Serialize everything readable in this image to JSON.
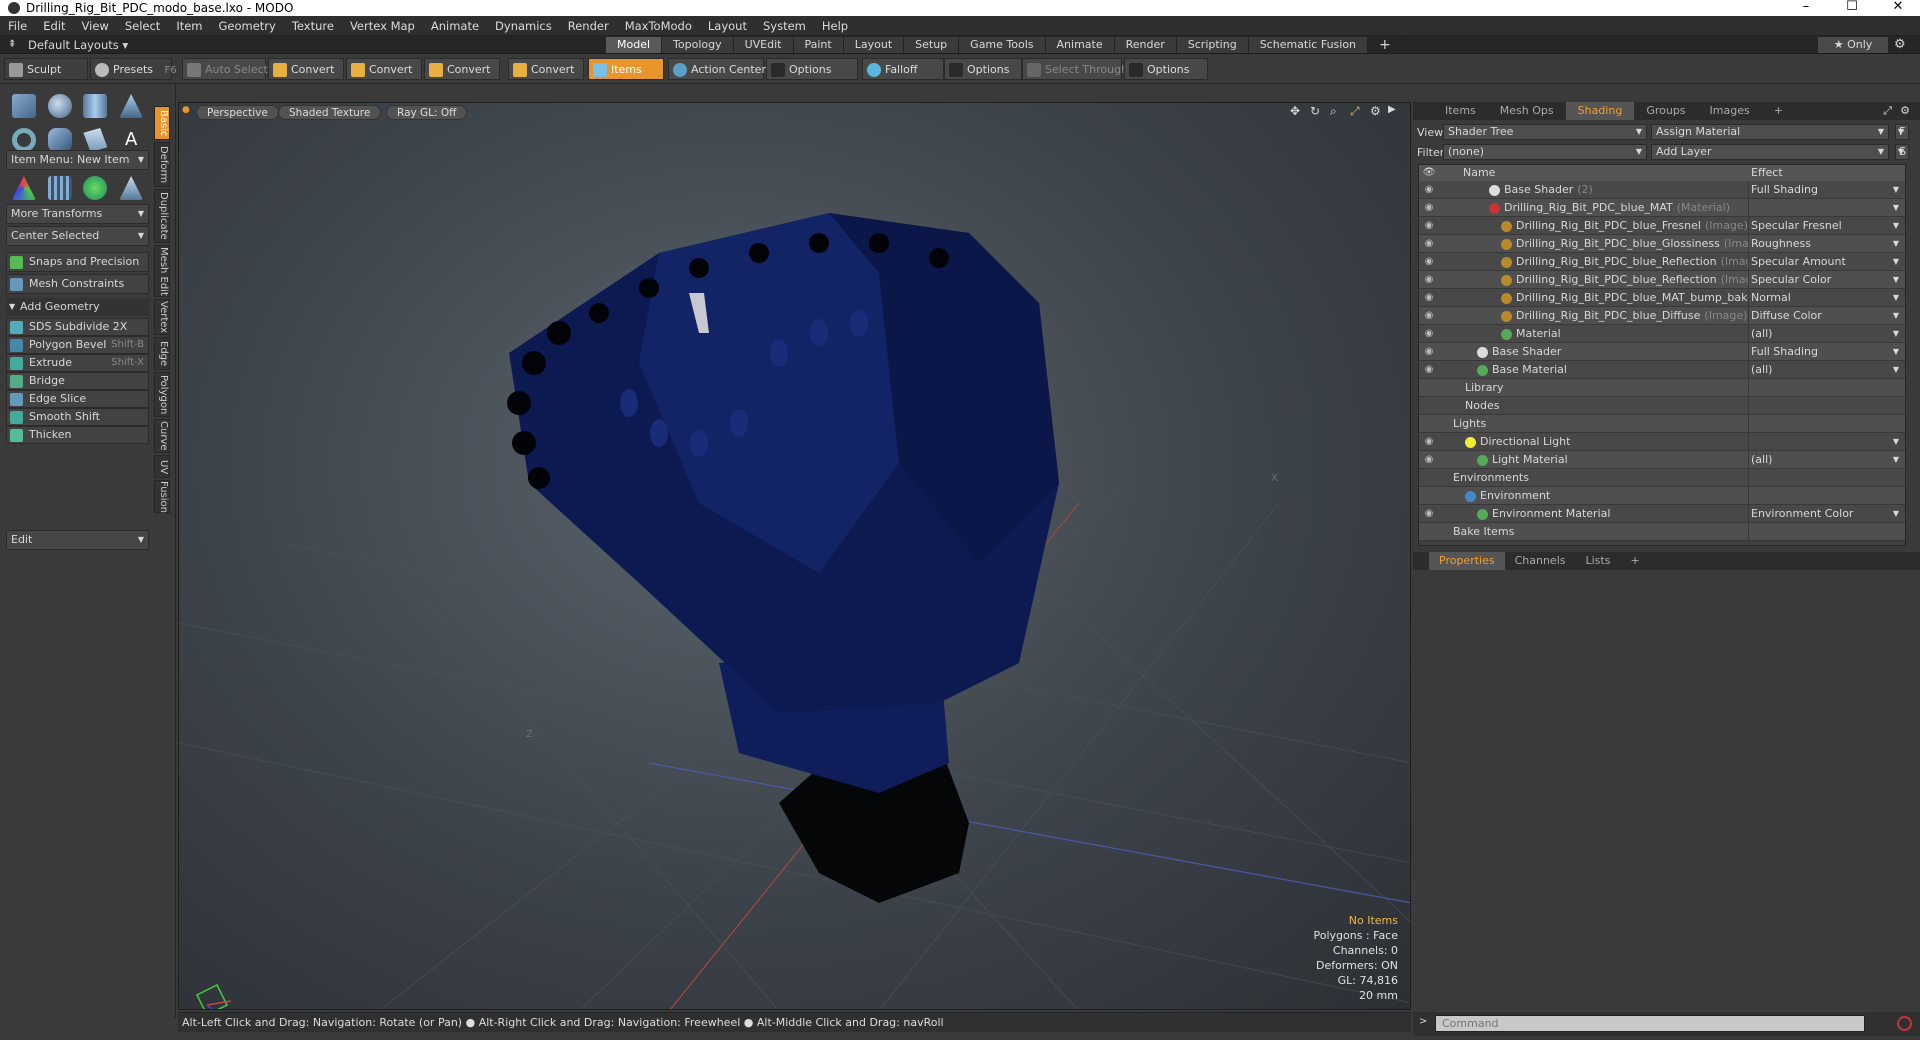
{
  "window": {
    "title": "Drilling_Rig_Bit_PDC_modo_base.lxo - MODO",
    "minimize": "–",
    "maximize": "☐",
    "close": "✕"
  },
  "menu": [
    "File",
    "Edit",
    "View",
    "Select",
    "Item",
    "Geometry",
    "Texture",
    "Vertex Map",
    "Animate",
    "Dynamics",
    "Render",
    "MaxToModo",
    "Layout",
    "System",
    "Help"
  ],
  "layout_bar": {
    "layout_select": "Default Layouts ▾",
    "tabs": [
      "Model",
      "Topology",
      "UVEdit",
      "Paint",
      "Layout",
      "Setup",
      "Game Tools",
      "Animate",
      "Render",
      "Scripting",
      "Schematic Fusion"
    ],
    "active_tab": "Model",
    "add_tab": "+",
    "only_label": "★ Only",
    "gear": "⚙"
  },
  "toolbar": {
    "sculpt": "Sculpt",
    "presets": "Presets",
    "presets_shortcut": "F6",
    "auto_select": "Auto Select",
    "convert1": "Convert",
    "convert2": "Convert",
    "convert3": "Convert",
    "convert4": "Convert",
    "items": "Items",
    "action_center": "Action Center",
    "options1": "Options",
    "falloff": "Falloff",
    "options2": "Options",
    "select_through": "Select Through",
    "options3": "Options"
  },
  "left_panel": {
    "item_menu": "Item Menu: New Item",
    "more_transforms": "More Transforms",
    "center_selected": "Center Selected",
    "snaps": "Snaps and Precision",
    "mesh_constraints": "Mesh Constraints",
    "add_geometry": "Add Geometry",
    "tools": [
      {
        "label": "SDS Subdivide 2X",
        "shortcut": ""
      },
      {
        "label": "Polygon Bevel",
        "shortcut": "Shift-B"
      },
      {
        "label": "Extrude",
        "shortcut": "Shift-X"
      },
      {
        "label": "Bridge",
        "shortcut": ""
      },
      {
        "label": "Edge Slice",
        "shortcut": ""
      },
      {
        "label": "Smooth Shift",
        "shortcut": ""
      },
      {
        "label": "Thicken",
        "shortcut": ""
      }
    ],
    "edit": "Edit",
    "vtabs": [
      "Basic",
      "Deform",
      "Duplicate",
      "Mesh Edit",
      "Vertex",
      "Edge",
      "Polygon",
      "Curve",
      "UV",
      "Fusion"
    ]
  },
  "viewport": {
    "perspective": "Perspective",
    "shading": "Shaded Texture",
    "raygl": "Ray GL: Off",
    "stats": {
      "no_items": "No Items",
      "polygons": "Polygons : Face",
      "channels": "Channels: 0",
      "deformers": "Deformers: ON",
      "gl": "GL: 74,816",
      "scale": "20 mm"
    },
    "axis_x": "X",
    "axis_z": "Z"
  },
  "status_bar": "Alt-Left Click and Drag: Navigation: Rotate (or Pan) ● Alt-Right Click and Drag: Navigation: Freewheel ● Alt-Middle Click and Drag: navRoll",
  "right_panel": {
    "tabs": [
      "Items",
      "Mesh Ops",
      "Shading",
      "Groups",
      "Images"
    ],
    "active_tab": "Shading",
    "add_tab": "+",
    "view_label": "View",
    "view_value": "Shader Tree",
    "assign_material": "Assign Material",
    "filter_label": "Filter",
    "filter_value": "(none)",
    "add_layer": "Add Layer",
    "f_btn": "F",
    "s_btn": "S",
    "columns": {
      "name": "Name",
      "effect": "Effect"
    },
    "tree": [
      {
        "indent": 3,
        "name": "Base Shader",
        "tag": "(2)",
        "effect": "Full Shading",
        "eye": true,
        "ball": "#ddd"
      },
      {
        "indent": 3,
        "name": "Drilling_Rig_Bit_PDC_blue_MAT",
        "tag": "(Material)",
        "effect": "",
        "eye": true,
        "ball": "#c33"
      },
      {
        "indent": 4,
        "name": "Drilling_Rig_Bit_PDC_blue_Fresnel",
        "tag": "(Image)",
        "effect": "Specular Fresnel",
        "eye": true,
        "ball": "#b98a2a"
      },
      {
        "indent": 4,
        "name": "Drilling_Rig_Bit_PDC_blue_Glossiness",
        "tag": "(Image)",
        "effect": "Roughness",
        "eye": true,
        "ball": "#b98a2a"
      },
      {
        "indent": 4,
        "name": "Drilling_Rig_Bit_PDC_blue_Reflection",
        "tag": "(Imag",
        "effect": "Specular Amount",
        "eye": true,
        "ball": "#b98a2a"
      },
      {
        "indent": 4,
        "name": "Drilling_Rig_Bit_PDC_blue_Reflection",
        "tag": "(Image)",
        "effect": "Specular Color",
        "eye": true,
        "ball": "#b98a2a"
      },
      {
        "indent": 4,
        "name": "Drilling_Rig_Bit_PDC_blue_MAT_bump_bake",
        "tag": "...",
        "effect": "Normal",
        "eye": true,
        "ball": "#b98a2a"
      },
      {
        "indent": 4,
        "name": "Drilling_Rig_Bit_PDC_blue_Diffuse",
        "tag": "(Image)",
        "effect": "Diffuse Color",
        "eye": true,
        "ball": "#b98a2a"
      },
      {
        "indent": 4,
        "name": "Material",
        "tag": "",
        "effect": "(all)",
        "eye": true,
        "ball": "#5a5"
      },
      {
        "indent": 2,
        "name": "Base Shader",
        "tag": "",
        "effect": "Full Shading",
        "eye": true,
        "ball": "#ddd"
      },
      {
        "indent": 2,
        "name": "Base Material",
        "tag": "",
        "effect": "(all)",
        "eye": true,
        "ball": "#5a5"
      },
      {
        "indent": 1,
        "name": "Library",
        "tag": "",
        "effect": "",
        "eye": false,
        "ball": ""
      },
      {
        "indent": 1,
        "name": "Nodes",
        "tag": "",
        "effect": "",
        "eye": false,
        "ball": ""
      },
      {
        "indent": 0,
        "name": "Lights",
        "tag": "",
        "effect": "",
        "eye": false,
        "ball": ""
      },
      {
        "indent": 1,
        "name": "Directional Light",
        "tag": "",
        "effect": "",
        "eye": true,
        "ball": "#ee3"
      },
      {
        "indent": 2,
        "name": "Light Material",
        "tag": "",
        "effect": "(all)",
        "eye": true,
        "ball": "#5a5"
      },
      {
        "indent": 0,
        "name": "Environments",
        "tag": "",
        "effect": "",
        "eye": false,
        "ball": ""
      },
      {
        "indent": 1,
        "name": "Environment",
        "tag": "",
        "effect": "",
        "eye": false,
        "ball": "#48c"
      },
      {
        "indent": 2,
        "name": "Environment Material",
        "tag": "",
        "effect": "Environment Color",
        "eye": true,
        "ball": "#5a5"
      },
      {
        "indent": 0,
        "name": "Bake Items",
        "tag": "",
        "effect": "",
        "eye": false,
        "ball": ""
      }
    ],
    "prop_tabs": [
      "Properties",
      "Channels",
      "Lists"
    ],
    "prop_active": "Properties",
    "prop_add": "+",
    "command_placeholder": "Command"
  }
}
